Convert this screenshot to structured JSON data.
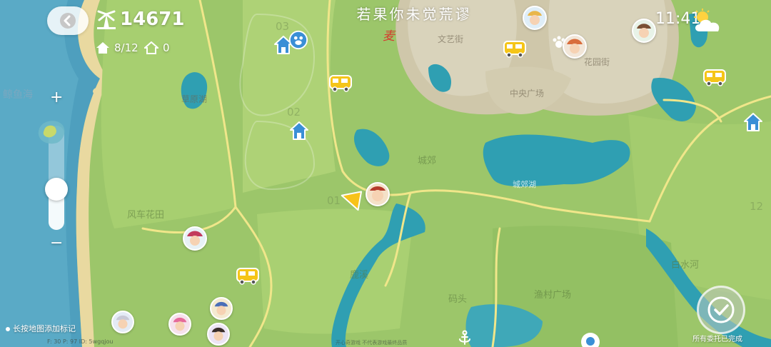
{
  "hud": {
    "coins": "14671",
    "residents": "8/12",
    "houses": "0",
    "time": "11:41",
    "weather_icon": "sun-cloud-icon",
    "back_icon": "back-arrow-icon",
    "currency_icon": "windmill-icon"
  },
  "title": {
    "text": "若果你未觉荒谬",
    "signature": "麦"
  },
  "map_labels": {
    "sea": "鲸鱼海",
    "lake_west": "草原湖",
    "windmill_garden": "风车花田",
    "suburb": "城郊",
    "suburb_lake": "城郊湖",
    "arts_street": "文艺街",
    "central_square": "中央广场",
    "garden_street": "花园街",
    "pier": "码头",
    "fishing_square": "渔村广场",
    "river": "白水河",
    "creek": "鹿溪",
    "zone_01": "01",
    "zone_02": "02",
    "zone_03": "03",
    "zone_12": "12"
  },
  "zoom": {
    "plus": "+",
    "minus": "−",
    "level": 0.36
  },
  "footer": {
    "hint": "长按地图添加标记",
    "coords": "F: 30    P: 97    ID: 5wgqjou",
    "note": "开心奇游戏   不代表游戏最终品质",
    "complete": "所有委托已完成"
  },
  "colors": {
    "grass": "#9cc66a",
    "grass_light": "#b5d67c",
    "water": "#3fa8b8",
    "sea": "#4e9fbe",
    "path": "#f0e68a",
    "town": "#d8d2b8",
    "house_icon": "#3a8fd6",
    "bus_icon": "#f5c518"
  }
}
